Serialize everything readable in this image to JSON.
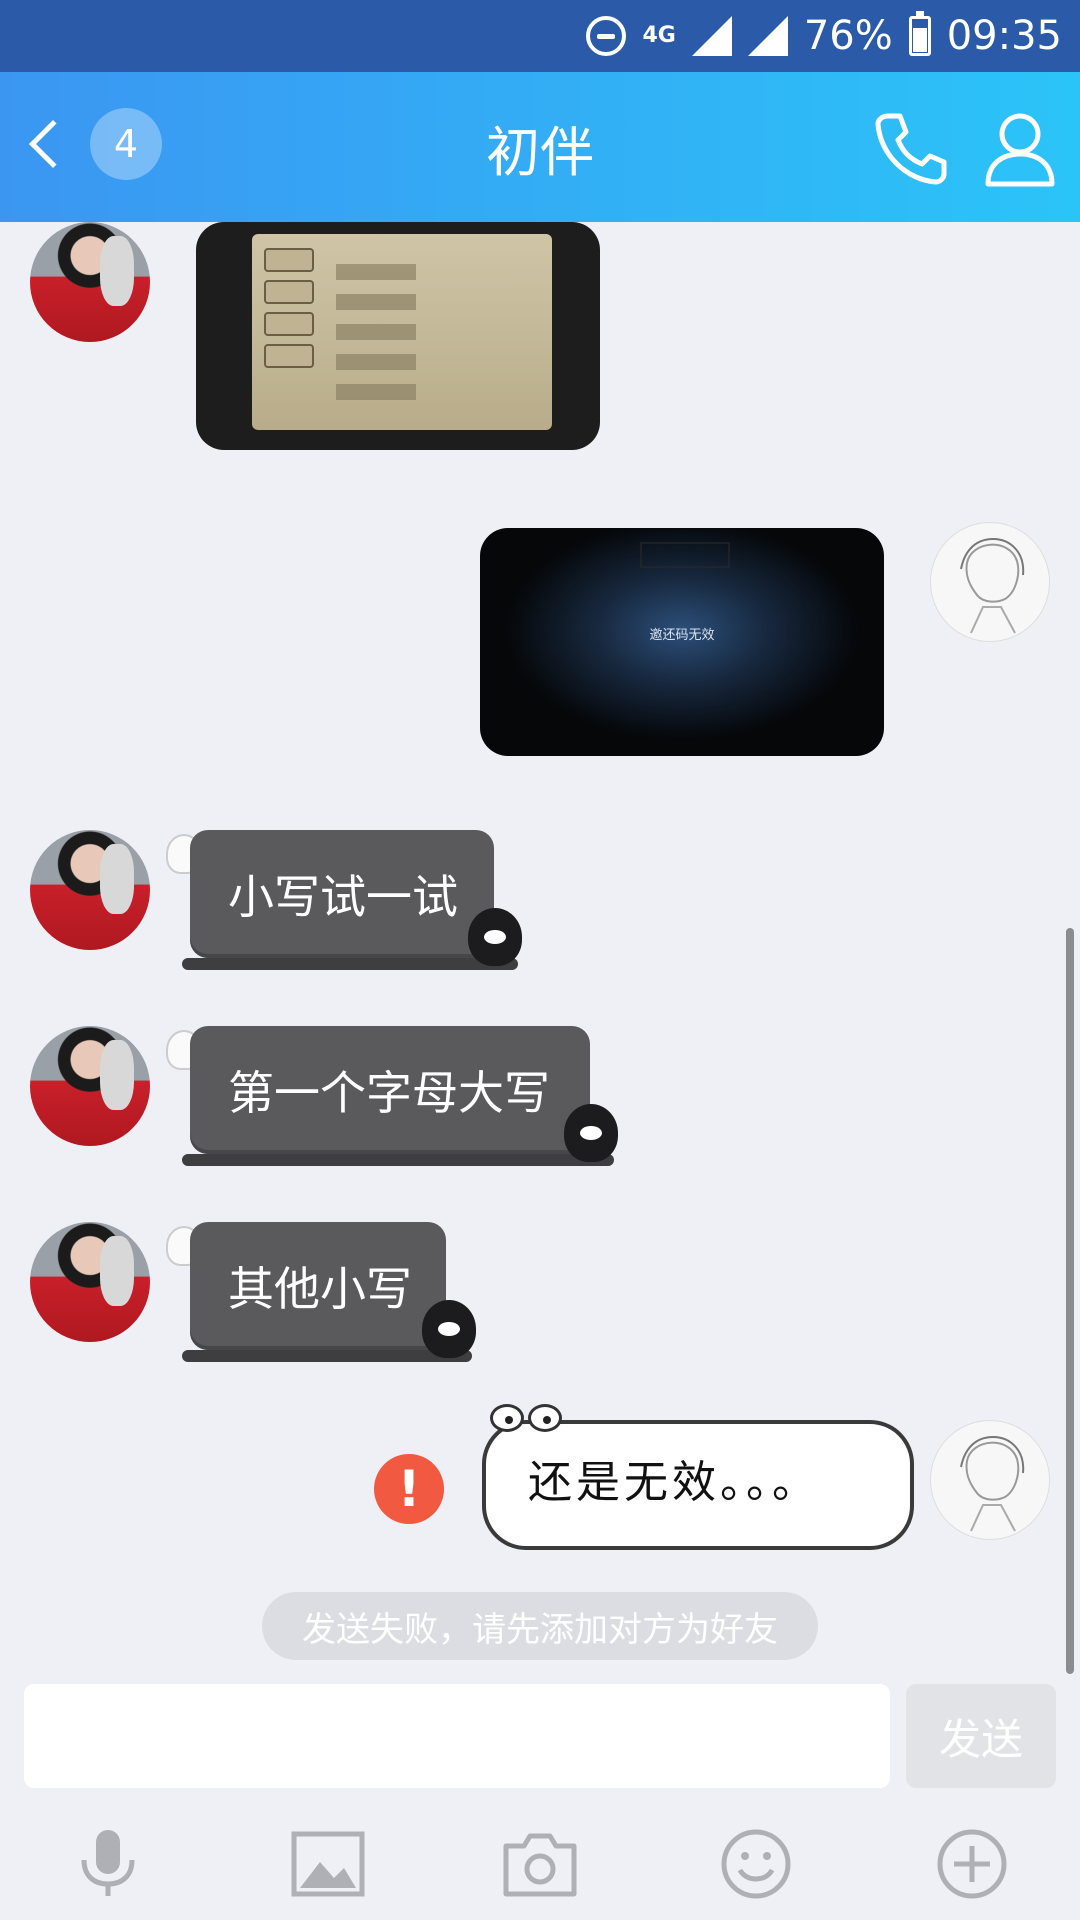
{
  "status_bar": {
    "network": "4G",
    "battery": "76%",
    "time": "09:35"
  },
  "header": {
    "back_badge": "4",
    "title": "初伴",
    "call_icon": "phone-icon",
    "profile_icon": "person-icon"
  },
  "messages": [
    {
      "side": "left",
      "type": "image"
    },
    {
      "side": "right",
      "type": "image",
      "image_text": "邀还码无效"
    },
    {
      "side": "left",
      "type": "text",
      "text": "小写试一试"
    },
    {
      "side": "left",
      "type": "text",
      "text": "第一个字母大写"
    },
    {
      "side": "left",
      "type": "text",
      "text": "其他小写"
    },
    {
      "side": "right",
      "type": "text",
      "text": "还是无效。。。",
      "status": "failed"
    }
  ],
  "system_tip": "发送失败，请先添加对方为好友",
  "input": {
    "value": "",
    "placeholder": "",
    "send_label": "发送"
  },
  "toolbar": [
    "microphone-icon",
    "image-icon",
    "camera-icon",
    "emoji-icon",
    "plus-icon"
  ],
  "colors": {
    "header_start": "#3b96f2",
    "header_end": "#2bc4f8",
    "bubble_dark": "#5a5a5c",
    "fail_red": "#f15a40",
    "background": "#eff0f5"
  }
}
